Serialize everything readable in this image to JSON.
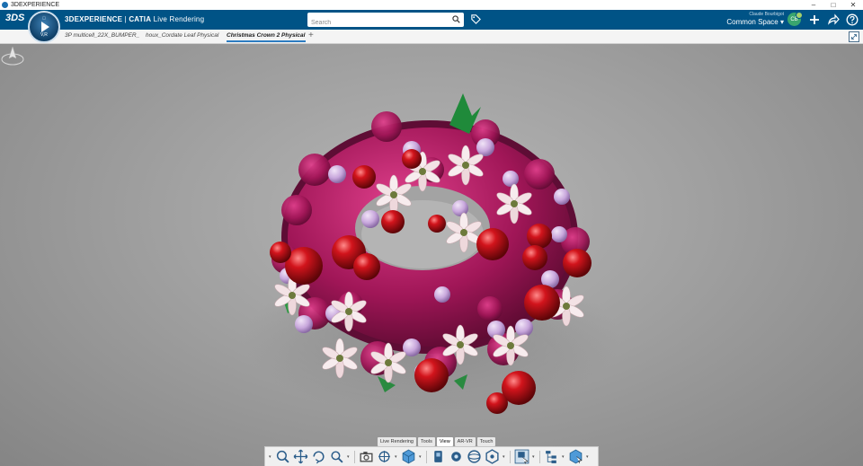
{
  "os": {
    "title": "3DEXPERIENCE"
  },
  "header": {
    "brand_main": "3DEXPERIENCE",
    "brand_sep": " | ",
    "brand_app": "CATIA",
    "brand_role": " Live Rendering",
    "compass_label": "V,R",
    "search_placeholder": "Search",
    "user_name": "Claude Bourbigot",
    "space": "Common Space",
    "avatar_initials": "CB"
  },
  "tabs": [
    {
      "label": "3P multicell_22X_BUMPER_"
    },
    {
      "label": "houx_Cordate Leaf Physical"
    },
    {
      "label": "Christmas Crown 2 Physical"
    }
  ],
  "action_bar": {
    "section_tabs": [
      "Live Rendering",
      "Tools",
      "View",
      "AR-VR",
      "Touch"
    ],
    "active_section": "View"
  },
  "colors": {
    "header_bg": "#005386",
    "accent": "#2d7cc1",
    "viewport_bg": "#a0a0a0"
  }
}
